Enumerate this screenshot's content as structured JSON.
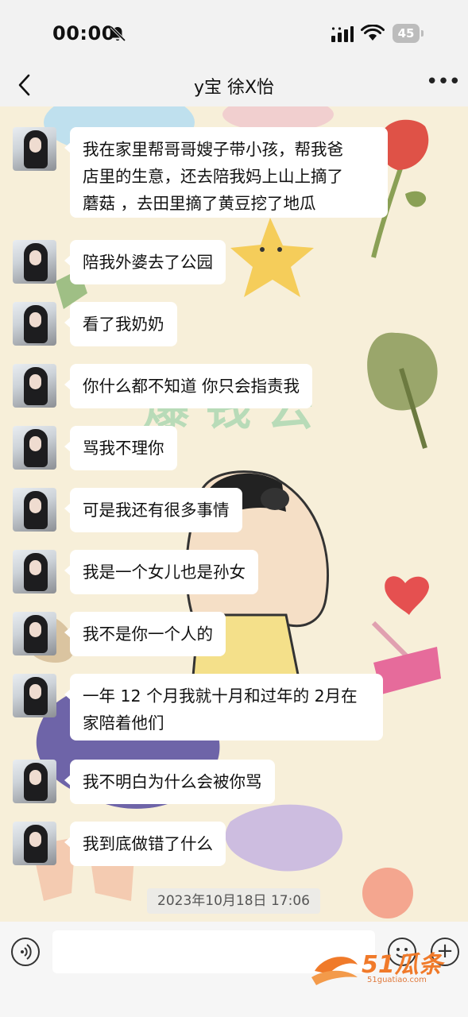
{
  "status_bar": {
    "time": "00:00",
    "battery": "45"
  },
  "nav": {
    "title": "y宝 徐X怡"
  },
  "messages": [
    {
      "text": "我在家里帮哥哥嫂子带小孩，帮我爸\n店里的生意，还去陪我妈上山上摘了\n蘑菇 ，去田里摘了黄豆挖了地瓜"
    },
    {
      "text": "陪我外婆去了公园"
    },
    {
      "text": "看了我奶奶"
    },
    {
      "text": "你什么都不知道 你只会指责我"
    },
    {
      "text": "骂我不理你"
    },
    {
      "text": "可是我还有很多事情"
    },
    {
      "text": "我是一个女儿也是孙女"
    },
    {
      "text": "我不是你一个人的"
    },
    {
      "text": "一年 12 个月我就十月和过年的 2月在\n家陪着他们"
    },
    {
      "text": "我不明白为什么会被你骂"
    },
    {
      "text": "我到底做错了什么"
    }
  ],
  "timestamp": "2023年10月18日 17:06",
  "watermark": {
    "brand": "51瓜条",
    "url": "51guatiao.com"
  },
  "colors": {
    "background": "#f7efd9",
    "bubble": "#ffffff",
    "watermark": "#f07a2a"
  }
}
